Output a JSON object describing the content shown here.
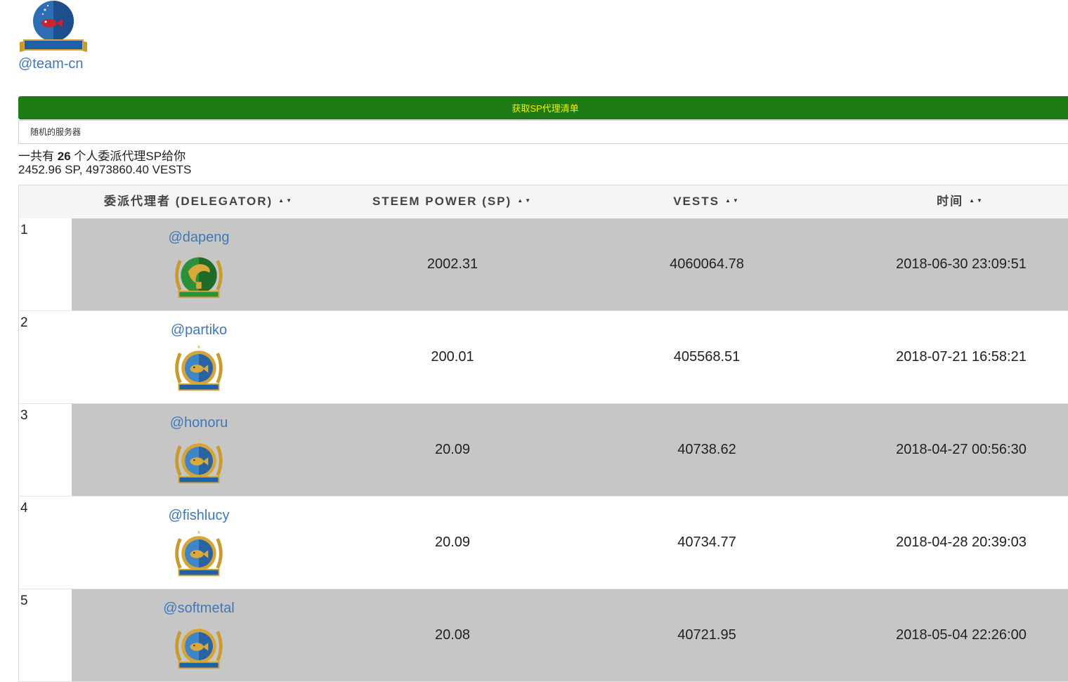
{
  "profile": {
    "username": "@team-cn",
    "badge_icon": "fishbowl-badge-icon"
  },
  "controls": {
    "fetch_label": "获取SP代理清单",
    "server_label": "随机的服务器"
  },
  "summary": {
    "prefix": "一共有",
    "count": "26",
    "suffix": "个人委派代理SP给你",
    "totals": "2452.96 SP, 4973860.40 VESTS"
  },
  "table": {
    "headers": {
      "delegator": "委派代理者 (DELEGATOR)",
      "sp": "STEEM POWER (SP)",
      "vests": "VESTS",
      "time": "时间"
    },
    "sort_glyph": "▲▼",
    "rows": [
      {
        "index": "1",
        "delegator": "@dapeng",
        "badge": "dolphin-badge-icon",
        "sp": "2002.31",
        "vests": "4060064.78",
        "time": "2018-06-30 23:09:51"
      },
      {
        "index": "2",
        "delegator": "@partiko",
        "badge": "fish-badge-icon",
        "sp": "200.01",
        "vests": "405568.51",
        "time": "2018-07-21 16:58:21"
      },
      {
        "index": "3",
        "delegator": "@honoru",
        "badge": "fish-badge-icon",
        "sp": "20.09",
        "vests": "40738.62",
        "time": "2018-04-27 00:56:30"
      },
      {
        "index": "4",
        "delegator": "@fishlucy",
        "badge": "fish-badge-icon",
        "sp": "20.09",
        "vests": "40734.77",
        "time": "2018-04-28 20:39:03"
      },
      {
        "index": "5",
        "delegator": "@softmetal",
        "badge": "fish-badge-icon",
        "sp": "20.08",
        "vests": "40721.95",
        "time": "2018-05-04 22:26:00"
      }
    ]
  },
  "colors": {
    "link": "#3f78b8",
    "button_bg": "#1e7a15",
    "button_text": "#f4f000",
    "row_shade": "#c6c6c6"
  }
}
